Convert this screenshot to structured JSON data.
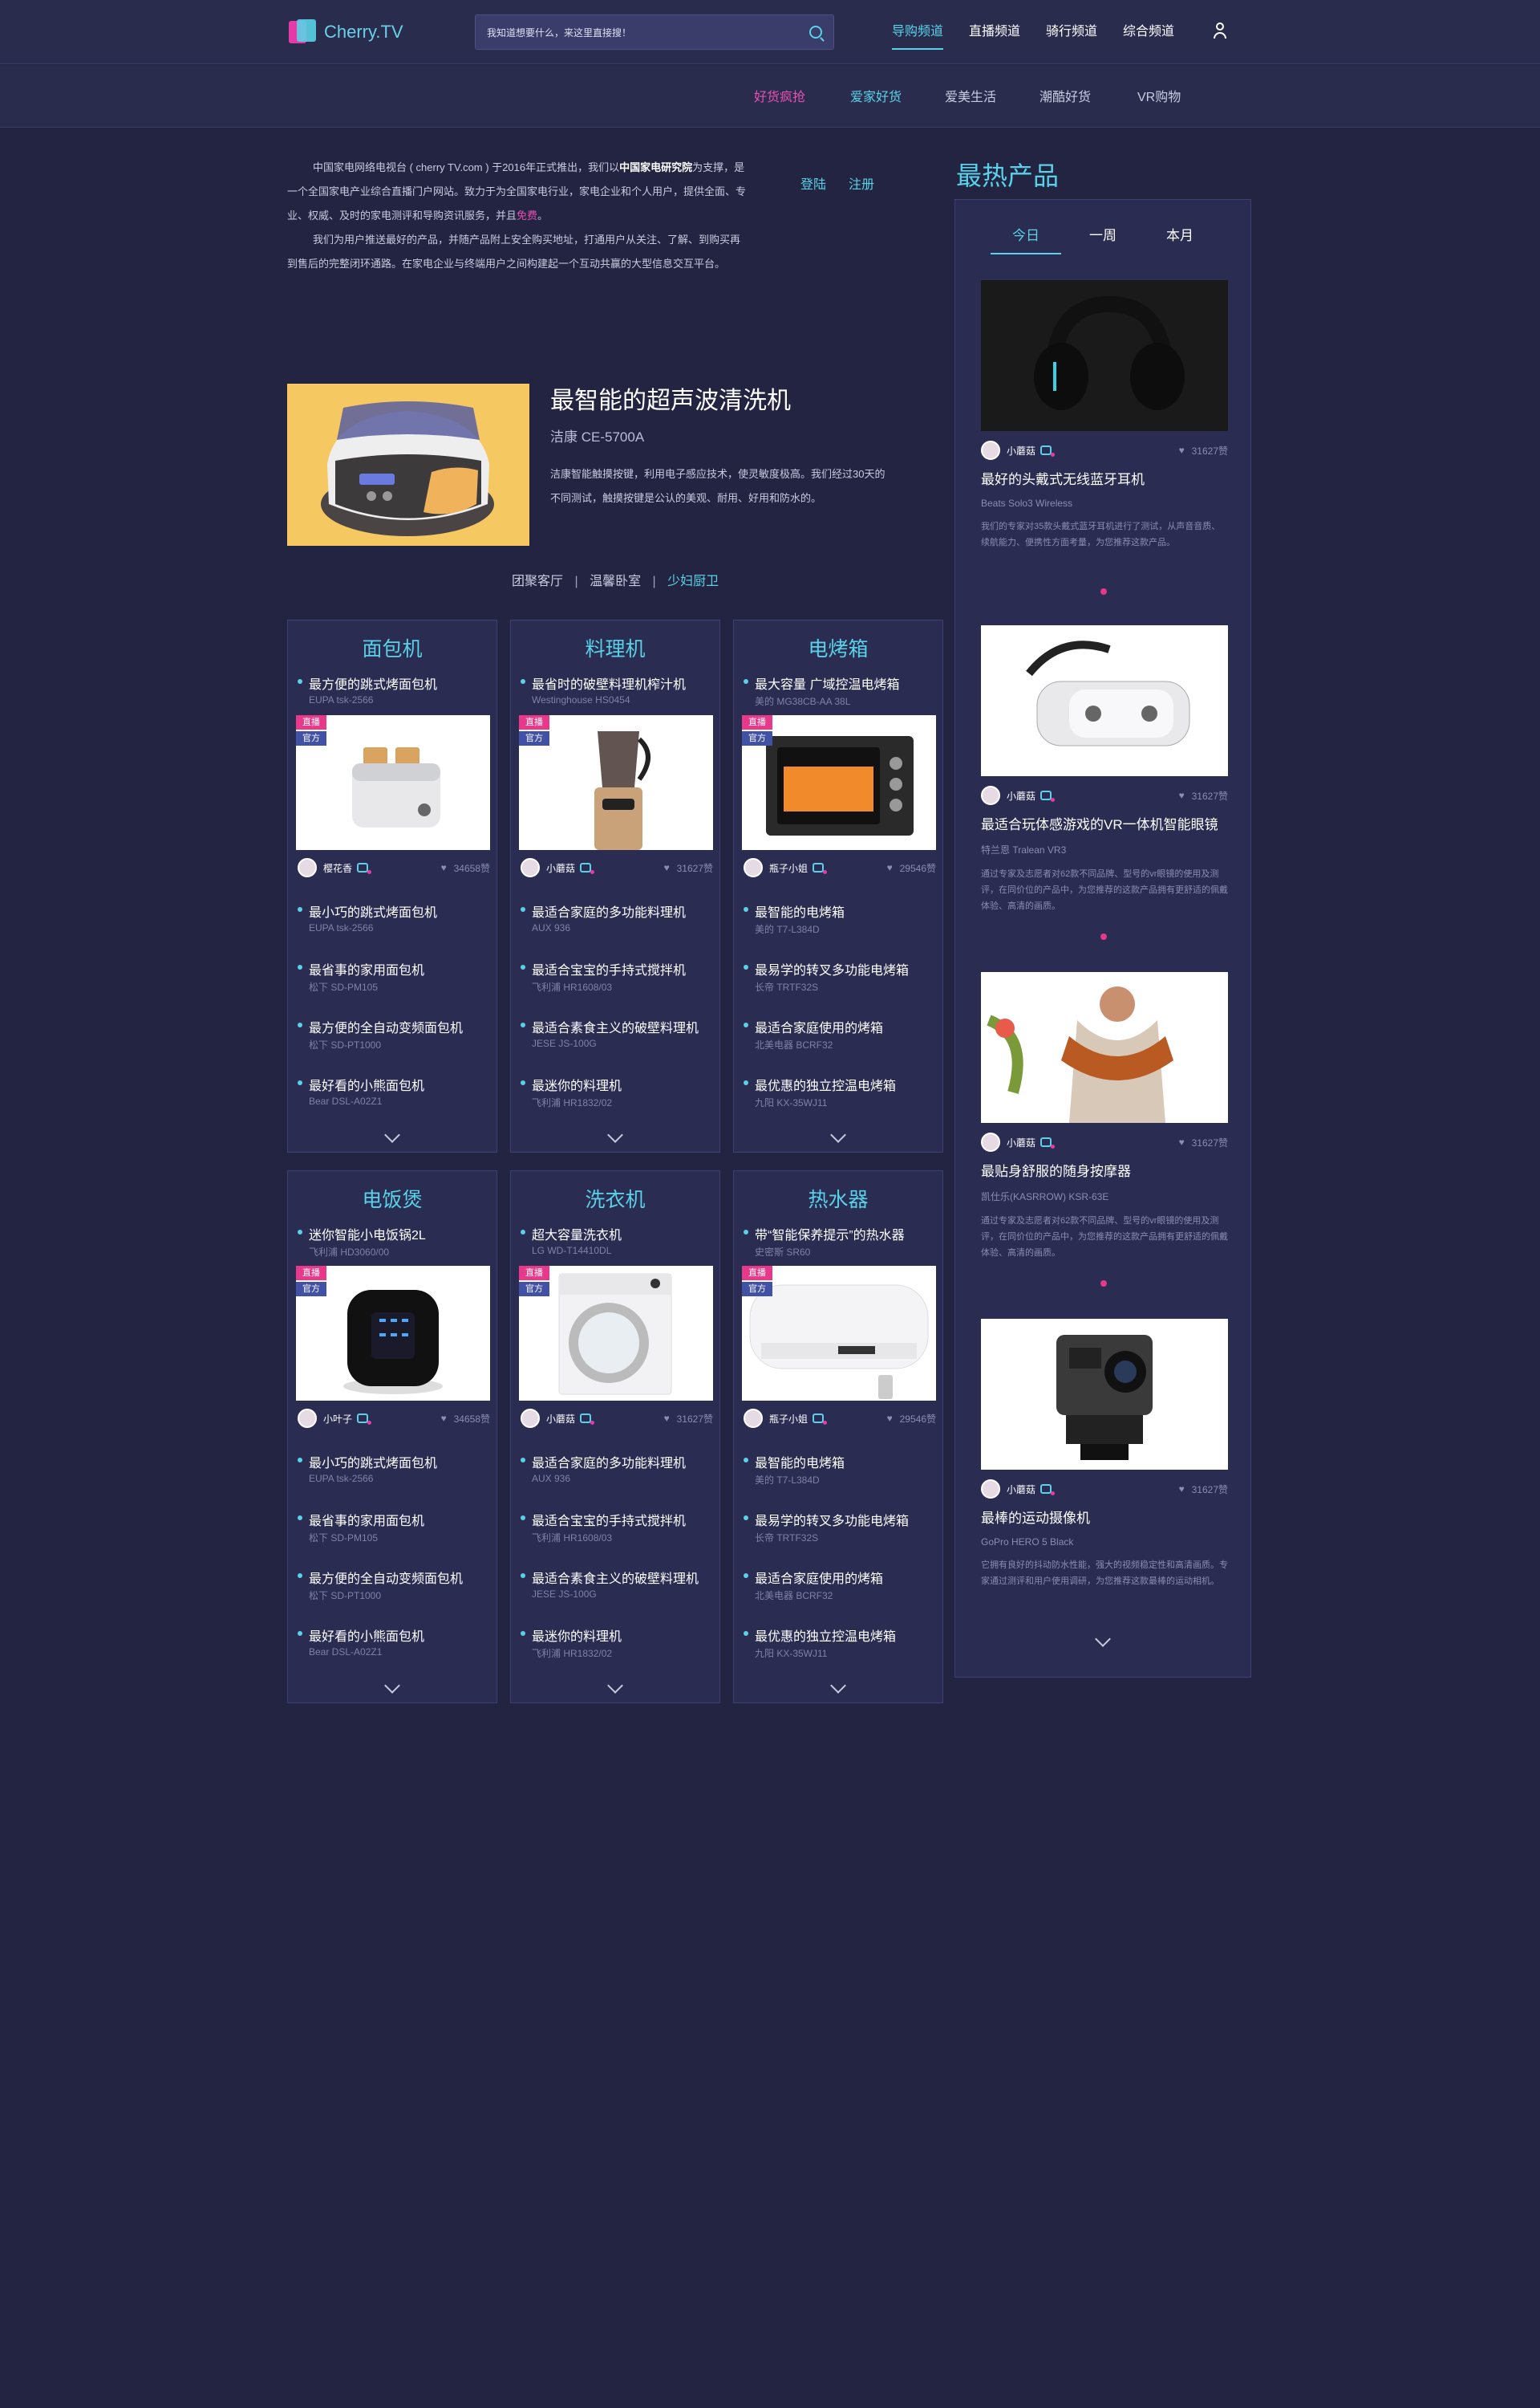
{
  "header": {
    "logo": "Cherry.TV",
    "search_placeholder": "我知道想要什么，来这里直接搜！",
    "nav": [
      "导购频道",
      "直播频道",
      "骑行频道",
      "综合频道"
    ]
  },
  "subnav": [
    "好货疯抢",
    "爱家好货",
    "爱美生活",
    "潮酷好货",
    "VR购物"
  ],
  "intro": {
    "p1a": "中国家电网络电视台 ( cherry TV.com ) 于2016年正式推出，我们以",
    "p1b": "中国家电研究院",
    "p1c": "为支撑，是一个全国家电产业综合直播门户网站。致力于为全国家电行业，家电企业和个人用户，提供全面、专业、权威、及时的家电测评和导购资讯服务，并且",
    "p1d": "免费",
    "p1e": "。",
    "p2": "我们为用户推送最好的产品，并随产品附上安全购买地址，打通用户从关注、了解、到购买再到售后的完整闭环通路。在家电企业与终端用户之间构建起一个互动共赢的大型信息交互平台。"
  },
  "auth": {
    "login": "登陆",
    "register": "注册"
  },
  "featured": {
    "title": "最智能的超声波清洗机",
    "model": "洁康 CE-5700A",
    "desc": "洁康智能触摸按键，利用电子感应技术，使灵敏度极高。我们经过30天的不同测试，触摸按键是公认的美观、耐用、好用和防水的。"
  },
  "categories": [
    "团聚客厅",
    "温馨卧室",
    "少妇厨卫"
  ],
  "cards": [
    {
      "title": "面包机",
      "top": {
        "name": "最方便的跳式烤面包机",
        "model": "EUPA tsk-2566"
      },
      "author": "樱花香",
      "likes": "34658赞",
      "items": [
        {
          "name": "最小巧的跳式烤面包机",
          "model": "EUPA tsk-2566"
        },
        {
          "name": "最省事的家用面包机",
          "model": "松下 SD-PM105"
        },
        {
          "name": "最方便的全自动变频面包机",
          "model": "松下 SD-PT1000"
        },
        {
          "name": "最好看的小熊面包机",
          "model": "Bear DSL-A02Z1"
        }
      ]
    },
    {
      "title": "料理机",
      "top": {
        "name": "最省时的破壁料理机榨汁机",
        "model": "Westinghouse HS0454"
      },
      "author": "小蘑菇",
      "likes": "31627赞",
      "items": [
        {
          "name": "最适合家庭的多功能料理机",
          "model": "AUX 936"
        },
        {
          "name": "最适合宝宝的手持式搅拌机",
          "model": "飞利浦 HR1608/03"
        },
        {
          "name": "最适合素食主义的破壁料理机",
          "model": "JESE JS-100G"
        },
        {
          "name": "最迷你的料理机",
          "model": "飞利浦 HR1832/02"
        }
      ]
    },
    {
      "title": "电烤箱",
      "top": {
        "name": "最大容量 广域控温电烤箱",
        "model": "美的 MG38CB-AA 38L"
      },
      "author": "瓶子小姐",
      "likes": "29546赞",
      "items": [
        {
          "name": "最智能的电烤箱",
          "model": "美的 T7-L384D"
        },
        {
          "name": "最易学的转叉多功能电烤箱",
          "model": "长帝 TRTF32S"
        },
        {
          "name": "最适合家庭使用的烤箱",
          "model": "北美电器 BCRF32"
        },
        {
          "name": "最优惠的独立控温电烤箱",
          "model": "九阳 KX-35WJ11"
        }
      ]
    },
    {
      "title": "电饭煲",
      "top": {
        "name": "迷你智能小电饭锅2L",
        "model": "飞利浦 HD3060/00"
      },
      "author": "小叶子",
      "likes": "34658赞",
      "items": [
        {
          "name": "最小巧的跳式烤面包机",
          "model": "EUPA tsk-2566"
        },
        {
          "name": "最省事的家用面包机",
          "model": "松下 SD-PM105"
        },
        {
          "name": "最方便的全自动变频面包机",
          "model": "松下 SD-PT1000"
        },
        {
          "name": "最好看的小熊面包机",
          "model": "Bear DSL-A02Z1"
        }
      ]
    },
    {
      "title": "洗衣机",
      "top": {
        "name": "超大容量洗衣机",
        "model": "LG WD-T14410DL"
      },
      "author": "小蘑菇",
      "likes": "31627赞",
      "items": [
        {
          "name": "最适合家庭的多功能料理机",
          "model": "AUX 936"
        },
        {
          "name": "最适合宝宝的手持式搅拌机",
          "model": "飞利浦 HR1608/03"
        },
        {
          "name": "最适合素食主义的破壁料理机",
          "model": "JESE JS-100G"
        },
        {
          "name": "最迷你的料理机",
          "model": "飞利浦 HR1832/02"
        }
      ]
    },
    {
      "title": "热水器",
      "top": {
        "name": "带“智能保养提示”的热水器",
        "model": "史密斯 SR60"
      },
      "author": "瓶子小姐",
      "likes": "29546赞",
      "items": [
        {
          "name": "最智能的电烤箱",
          "model": "美的 T7-L384D"
        },
        {
          "name": "最易学的转叉多功能电烤箱",
          "model": "长帝 TRTF32S"
        },
        {
          "name": "最适合家庭使用的烤箱",
          "model": "北美电器 BCRF32"
        },
        {
          "name": "最优惠的独立控温电烤箱",
          "model": "九阳 KX-35WJ11"
        }
      ]
    }
  ],
  "tags": {
    "live": "直播",
    "official": "官方"
  },
  "sidebar": {
    "title": "最热产品",
    "tabs": [
      "今日",
      "一周",
      "本月"
    ],
    "items": [
      {
        "author": "小蘑菇",
        "likes": "31627赞",
        "title": "最好的头戴式无线蓝牙耳机",
        "model": "Beats Solo3 Wireless",
        "desc": "我们的专家对35款头戴式蓝牙耳机进行了测试，从声音音质、续航能力、便携性方面考量，为您推荐这款产品。"
      },
      {
        "author": "小蘑菇",
        "likes": "31627赞",
        "title": "最适合玩体感游戏的VR一体机智能眼镜",
        "model": "特兰恩 Tralean VR3",
        "desc": "通过专家及志愿者对62款不同品牌、型号的vr眼镜的使用及测评，在同价位的产品中，为您推荐的这款产品拥有更舒适的佩戴体验、高清的画质。"
      },
      {
        "author": "小蘑菇",
        "likes": "31627赞",
        "title": "最贴身舒服的随身按摩器",
        "model": "凯仕乐(KASRROW) KSR-63E",
        "desc": "通过专家及志愿者对62款不同品牌、型号的vr眼镜的使用及测评，在同价位的产品中，为您推荐的这款产品拥有更舒适的佩戴体验、高清的画质。"
      },
      {
        "author": "小蘑菇",
        "likes": "31627赞",
        "title": "最棒的运动摄像机",
        "model": "GoPro HERO 5 Black",
        "desc": "它拥有良好的抖动防水性能，强大的视频稳定性和高清画质。专家通过测评和用户使用调研，为您推荐这款最棒的运动相机。"
      }
    ]
  }
}
